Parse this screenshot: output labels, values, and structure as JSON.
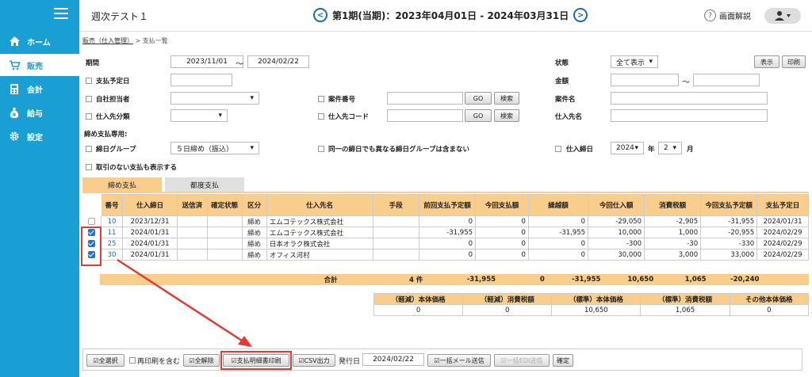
{
  "header": {
    "title": "週次テスト１",
    "period": "第1期(当期)：2023年04月01日 - 2024年03月31日",
    "help": "画面解説"
  },
  "nav": [
    {
      "label": "ホーム",
      "icon": "home-icon"
    },
    {
      "label": "販売",
      "icon": "cart-icon"
    },
    {
      "label": "会計",
      "icon": "calculator-icon"
    },
    {
      "label": "給与",
      "icon": "money-bag-icon"
    },
    {
      "label": "設定",
      "icon": "gear-icon"
    }
  ],
  "breadcrumb": {
    "link": "販売（仕入管理）",
    "sep": ">",
    "current": "支払一覧"
  },
  "filters": {
    "period_label": "期間",
    "date_from": "2023/11/01",
    "tilde": "〜",
    "date_to": "2024/02/22",
    "status_label": "状態",
    "status_value": "全て表示",
    "display_btn": "表示",
    "print_btn": "印刷",
    "pay_date_label": "支払予定日",
    "amount_label": "金額",
    "own_staff_label": "自社担当者",
    "case_no_label": "案件番号",
    "go": "GO",
    "search": "検索",
    "case_name_label": "案件名",
    "supplier_class_label": "仕入先分類",
    "supplier_code_label": "仕入先コード",
    "supplier_name_label": "仕入先名",
    "closing_only": "締め支払専用:",
    "closing_group_label": "締日グループ",
    "closing_group_value": "５日締め（振込）",
    "diff_group_label": "同一の締日でも異なる締日グループは含まない",
    "supplier_close_label": "仕入締日",
    "year_value": "2024",
    "year_unit": "年",
    "month_value": "2",
    "month_unit": "月",
    "show_no_tx_label": "取引のない支払も表示する"
  },
  "tabs": [
    "締め支払",
    "都度支払"
  ],
  "grid": {
    "headers": [
      "番号",
      "仕入締日",
      "送信済",
      "確定状態",
      "区分",
      "仕入先名",
      "手段",
      "前回支払予定額",
      "今回支払額",
      "繰越額",
      "今回仕入額",
      "消費税額",
      "今回支払予定額",
      "支払予定日"
    ],
    "rows": [
      {
        "checked": false,
        "no": "10",
        "date": "2023/12/31",
        "sent": "",
        "fixed": "",
        "kubun": "締め",
        "name": "エムコテックス株式会社",
        "means": "",
        "prev": "0",
        "paid": "0",
        "carry": "0",
        "purchase": "-29,050",
        "tax": "-2,905",
        "plan": "-31,955",
        "pdate": "2024/01/31"
      },
      {
        "checked": true,
        "no": "11",
        "date": "2024/01/31",
        "sent": "",
        "fixed": "",
        "kubun": "締め",
        "name": "エムコテックス株式会社",
        "means": "",
        "prev": "-31,955",
        "paid": "0",
        "carry": "-31,955",
        "purchase": "10,000",
        "tax": "1,000",
        "plan": "-20,955",
        "pdate": "2024/02/29"
      },
      {
        "checked": true,
        "no": "25",
        "date": "2024/01/31",
        "sent": "",
        "fixed": "",
        "kubun": "締め",
        "name": "日本オラク株式会社",
        "means": "",
        "prev": "0",
        "paid": "0",
        "carry": "0",
        "purchase": "-300",
        "tax": "-30",
        "plan": "-330",
        "pdate": "2024/02/29"
      },
      {
        "checked": true,
        "no": "30",
        "date": "2024/01/31",
        "sent": "",
        "fixed": "",
        "kubun": "締め",
        "name": "オフィス河村",
        "means": "",
        "prev": "0",
        "paid": "0",
        "carry": "0",
        "purchase": "30,000",
        "tax": "3,000",
        "plan": "33,000",
        "pdate": "2024/02/29"
      }
    ]
  },
  "totals": {
    "label": "合計",
    "count": "4 件",
    "prev": "-31,955",
    "paid": "0",
    "carry": "-31,955",
    "purchase": "10,650",
    "tax": "1,065",
    "plan": "-20,240"
  },
  "summary": {
    "headers": [
      "（軽減）本体価格",
      "（軽減）消費税額",
      "（標準）本体価格",
      "（標準）消費税額",
      "その他本体価格"
    ],
    "values": [
      "0",
      "0",
      "10,650",
      "1,065",
      "0"
    ]
  },
  "toolbar": {
    "select_all": "全選択",
    "reprint": "再印刷を含む",
    "clear_all": "全解除",
    "print_stmt": "支払明細書印刷",
    "csv": "CSV出力",
    "issue_label": "発行日",
    "issue_date": "2024/02/22",
    "mail": "一括メール送信",
    "edi": "一括EDI送信",
    "confirm": "確定"
  },
  "colors": {
    "sidebar": "#1a9fd4",
    "header_row": "#f9cd8b",
    "tab_active": "#f9cd8b",
    "tab_inactive": "#e0e0e0",
    "highlight": "#e53935",
    "checkbox": "#1a73e8"
  }
}
